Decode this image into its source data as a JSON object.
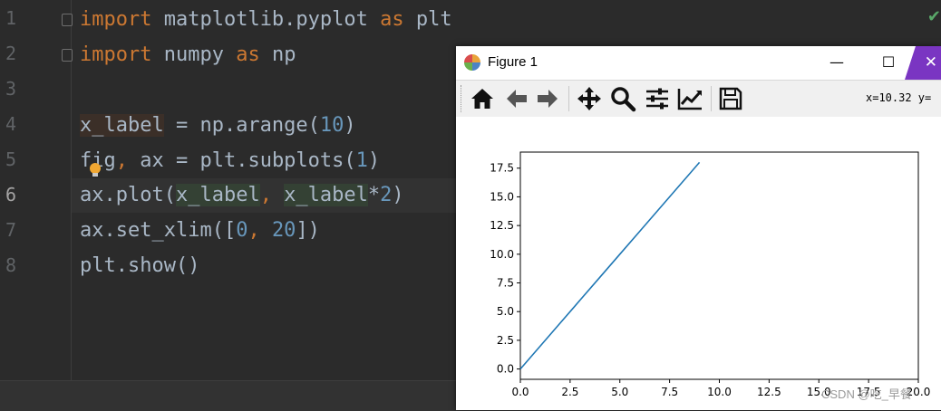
{
  "editor": {
    "line_numbers": [
      "1",
      "2",
      "3",
      "4",
      "5",
      "6",
      "7",
      "8"
    ],
    "active_line": "6",
    "lines": {
      "l1": {
        "kw1": "import",
        "mod": " matplotlib.pyplot ",
        "kw2": "as",
        "alias": " plt"
      },
      "l2": {
        "kw1": "import",
        "mod": " numpy ",
        "kw2": "as",
        "alias": " np"
      },
      "l4": {
        "var": "x_label",
        "rest": " = np.arange(",
        "num": "10",
        "close": ")"
      },
      "l5": {
        "a": "fig",
        "comma": ",",
        "b": " ax = plt.subplots(",
        "num": "1",
        "close": ")"
      },
      "l6": {
        "a": "ax.plot(",
        "v1": "x_label",
        "comma": ",",
        "sp": " ",
        "v2": "x_label",
        "op": "*",
        "num": "2",
        "close": ")"
      },
      "l7": {
        "a": "ax.set_xlim([",
        "n1": "0",
        "comma": ",",
        "sp": " ",
        "n2": "20",
        "close": "])"
      },
      "l8": {
        "a": "plt.show()"
      }
    },
    "status_check": "✔"
  },
  "figure": {
    "title": "Figure 1",
    "minimize": "—",
    "maximize": "☐",
    "close": "✕",
    "toolbar_icons": [
      "home-icon",
      "back-arrow-icon",
      "forward-arrow-icon",
      "pan-icon",
      "zoom-icon",
      "configure-subplots-icon",
      "edit-axis-icon",
      "save-icon"
    ],
    "coords": "x=10.32 y="
  },
  "chart_data": {
    "type": "line",
    "title": "",
    "xlabel": "",
    "ylabel": "",
    "xlim": [
      0,
      20
    ],
    "ylim": [
      -0.9,
      18.9
    ],
    "xticks": [
      "0.0",
      "2.5",
      "5.0",
      "7.5",
      "10.0",
      "12.5",
      "15.0",
      "17.5",
      "20.0"
    ],
    "yticks": [
      "0.0",
      "2.5",
      "5.0",
      "7.5",
      "10.0",
      "12.5",
      "15.0",
      "17.5"
    ],
    "grid": false,
    "series": [
      {
        "color": "#1f77b4",
        "x": [
          0,
          1,
          2,
          3,
          4,
          5,
          6,
          7,
          8,
          9
        ],
        "y": [
          0,
          2,
          4,
          6,
          8,
          10,
          12,
          14,
          16,
          18
        ]
      }
    ]
  },
  "watermark": "CSDN @吃_早餐"
}
